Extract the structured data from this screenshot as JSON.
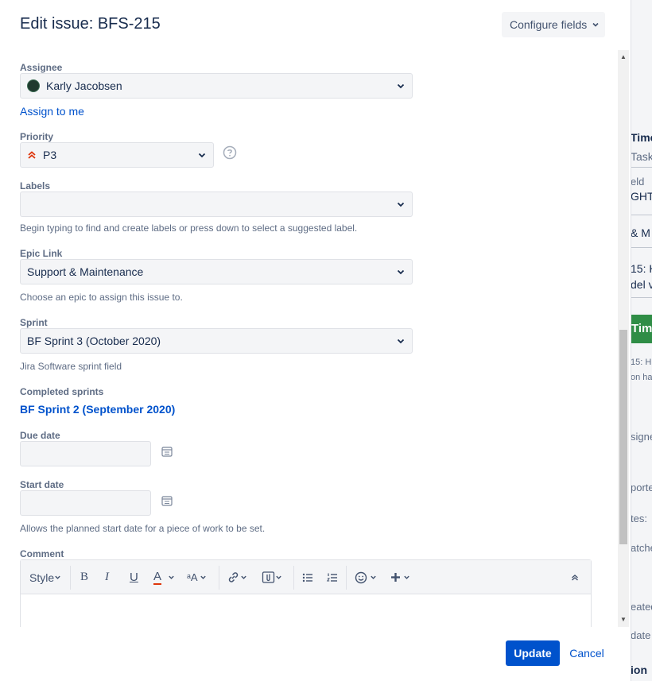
{
  "dialog": {
    "title": "Edit issue: BFS-215",
    "configure_label": "Configure fields"
  },
  "fields": {
    "assignee": {
      "label": "Assignee",
      "value": "Karly Jacobsen",
      "assign_link": "Assign to me"
    },
    "priority": {
      "label": "Priority",
      "value": "P3"
    },
    "labels": {
      "label": "Labels",
      "value": "",
      "help": "Begin typing to find and create labels or press down to select a suggested label."
    },
    "epic": {
      "label": "Epic Link",
      "value": "Support & Maintenance",
      "help": "Choose an epic to assign this issue to."
    },
    "sprint": {
      "label": "Sprint",
      "value": "BF Sprint 3 (October 2020)",
      "help": "Jira Software sprint field"
    },
    "completed_sprints": {
      "label": "Completed sprints",
      "value": "BF Sprint 2 (September 2020)"
    },
    "due_date": {
      "label": "Due date",
      "value": ""
    },
    "start_date": {
      "label": "Start date",
      "value": "",
      "help": "Allows the planned start date for a piece of work to be set."
    },
    "comment": {
      "label": "Comment",
      "toolbar": {
        "style": "Style",
        "bold": "B",
        "italic": "I",
        "underline": "U",
        "color": "A",
        "text_size": "ᵃA"
      }
    }
  },
  "footer": {
    "update_label": "Update",
    "cancel_label": "Cancel"
  },
  "background_page": {
    "texts": [
      "Time",
      "Task",
      "eld",
      "GHT",
      "& M",
      "15: H",
      "del v",
      "Tim",
      "15: H",
      "on ha",
      "signe",
      "porte",
      "tes:",
      "atche",
      "eated",
      "date",
      "ion"
    ]
  },
  "colors": {
    "accent": "#0052cc",
    "priority_red": "#de350b",
    "green": "#2f8d46"
  }
}
